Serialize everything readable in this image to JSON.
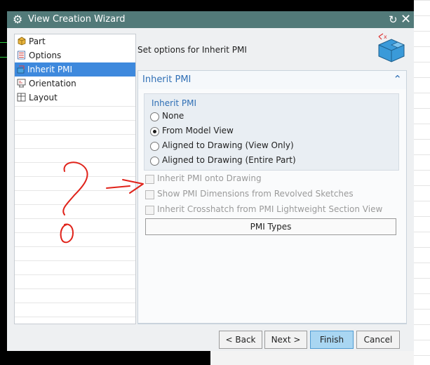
{
  "window": {
    "title": "View Creation Wizard",
    "icons": {
      "settings": "gear-icon",
      "reset": "reset-icon",
      "close": "close-icon"
    }
  },
  "nav": {
    "items": [
      {
        "label": "Part",
        "icon": "cube-icon",
        "selected": false
      },
      {
        "label": "Options",
        "icon": "options-icon",
        "selected": false
      },
      {
        "label": "Inherit PMI",
        "icon": "pmi-icon",
        "selected": true
      },
      {
        "label": "Orientation",
        "icon": "orientation-icon",
        "selected": false
      },
      {
        "label": "Layout",
        "icon": "layout-icon",
        "selected": false
      }
    ]
  },
  "header": {
    "text": "Set options for Inherit PMI",
    "icon": "view-wizard-icon"
  },
  "panel": {
    "title": "Inherit PMI",
    "group_title": "Inherit PMI",
    "radios": [
      {
        "label": "None",
        "checked": false
      },
      {
        "label": "From Model View",
        "checked": true
      },
      {
        "label": "Aligned to Drawing (View Only)",
        "checked": false
      },
      {
        "label": "Aligned to Drawing (Entire Part)",
        "checked": false
      }
    ],
    "checkboxes": [
      {
        "label": "Inherit PMI onto Drawing",
        "checked": false,
        "enabled": false
      },
      {
        "label": "Show PMI Dimensions from Revolved Sketches",
        "checked": false,
        "enabled": false
      },
      {
        "label": "Inherit Crosshatch from PMI Lightweight Section View",
        "checked": false,
        "enabled": false
      }
    ],
    "pmi_types_label": "PMI Types"
  },
  "footer": {
    "back": "< Back",
    "next": "Next >",
    "finish": "Finish",
    "cancel": "Cancel"
  },
  "colors": {
    "titlebar": "#527a79",
    "selection": "#3e89dd",
    "section_title": "#2f6fb5",
    "annotation": "#e0231a"
  }
}
